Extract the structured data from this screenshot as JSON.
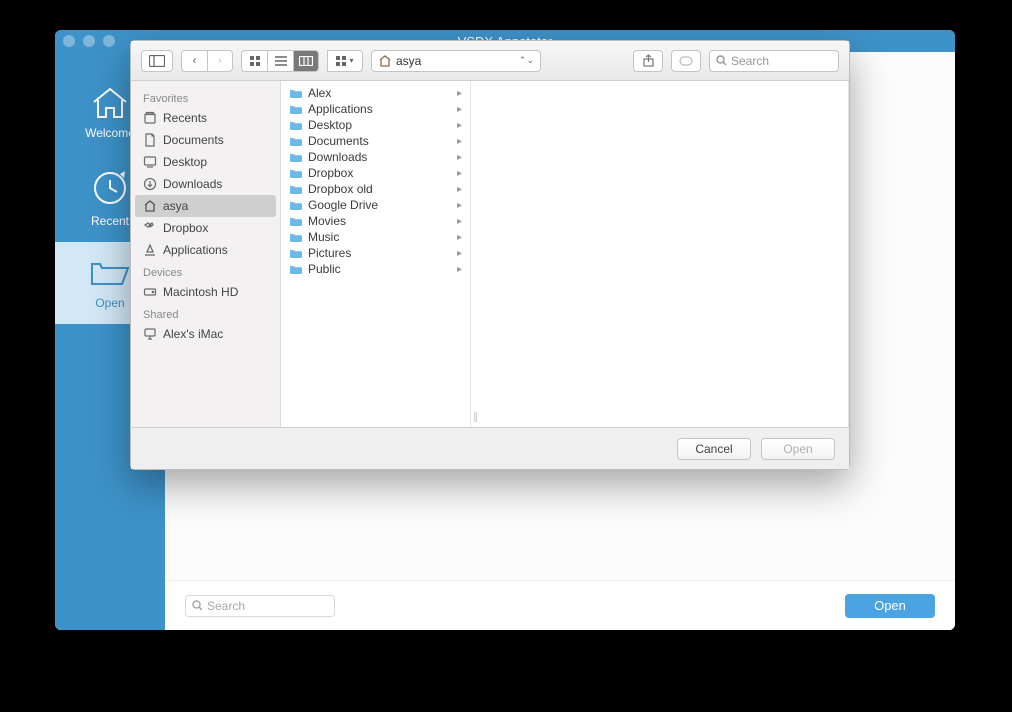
{
  "title": "VSDX Annotator",
  "nav": {
    "welcome": "Welcome",
    "recent": "Recent",
    "open": "Open"
  },
  "bottom": {
    "search_ph": "Search",
    "open_btn": "Open"
  },
  "finder": {
    "path_location": "asya",
    "search_ph": "Search",
    "sidebar": {
      "favorites_label": "Favorites",
      "devices_label": "Devices",
      "shared_label": "Shared",
      "favorites": [
        "Recents",
        "Documents",
        "Desktop",
        "Downloads",
        "asya",
        "Dropbox",
        "Applications"
      ],
      "devices": [
        "Macintosh HD"
      ],
      "shared": [
        "Alex's iMac"
      ]
    },
    "folders": [
      "Alex",
      "Applications",
      "Desktop",
      "Documents",
      "Downloads",
      "Dropbox",
      "Dropbox old",
      "Google Drive",
      "Movies",
      "Music",
      "Pictures",
      "Public"
    ],
    "cancel": "Cancel",
    "open": "Open"
  }
}
